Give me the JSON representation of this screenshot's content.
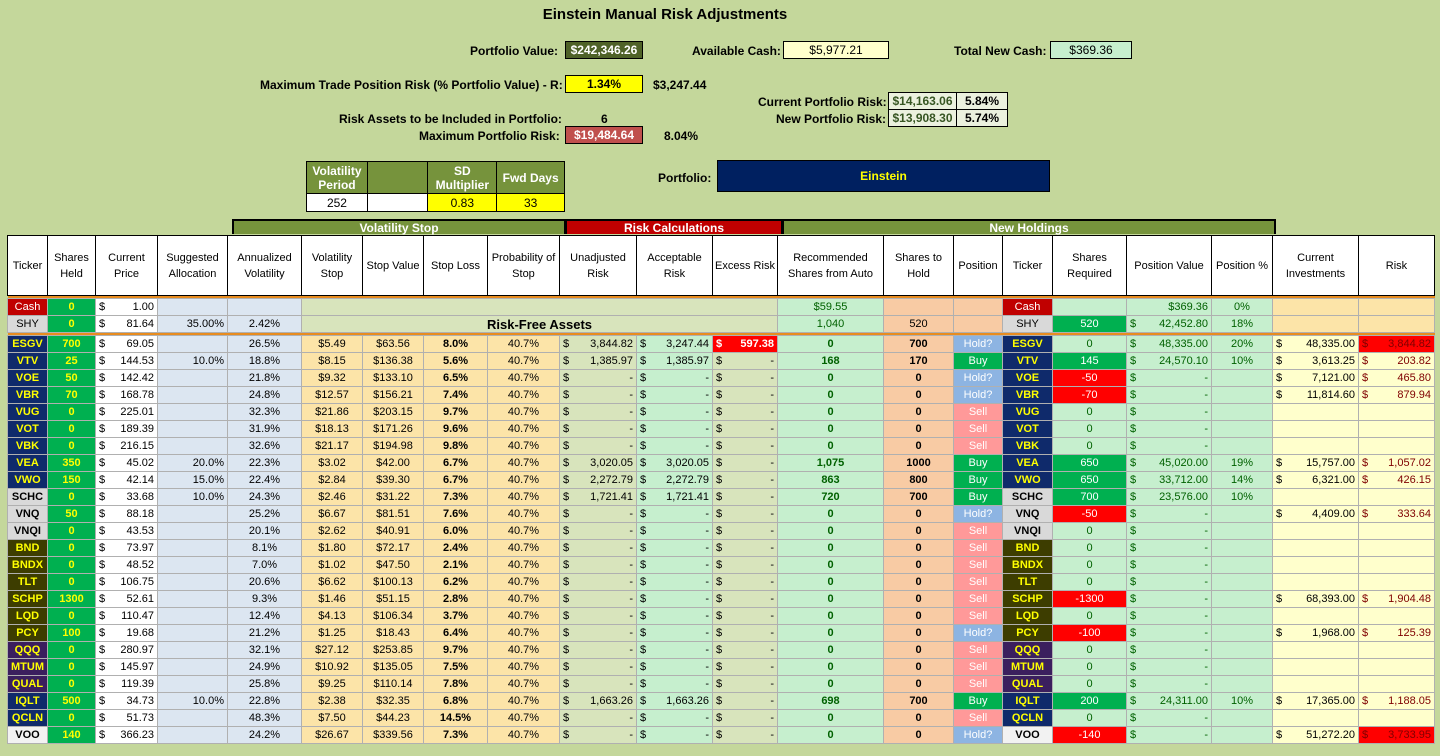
{
  "title": "Einstein Manual Risk Adjustments",
  "summary": {
    "portfolio_value_label": "Portfolio Value:",
    "portfolio_value": "$242,346.26",
    "available_cash_label": "Available Cash:",
    "available_cash": "$5,977.21",
    "total_new_cash_label": "Total New Cash:",
    "total_new_cash": "$369.36",
    "max_trade_label": "Maximum Trade Position Risk (% Portfolio Value) - R:",
    "max_trade_pct": "1.34%",
    "max_trade_value": "$3,247.44",
    "current_risk_label": "Current Portfolio Risk:",
    "current_risk_value": "$14,163.06",
    "current_risk_pct": "5.84%",
    "new_risk_label": "New Portfolio Risk:",
    "new_risk_value": "$13,908.30",
    "new_risk_pct": "5.74%",
    "risk_assets_label": "Risk Assets to be Included in Portfolio:",
    "risk_assets": "6",
    "max_portfolio_risk_label": "Maximum Portfolio Risk:",
    "max_portfolio_risk": "$19,484.64",
    "max_portfolio_risk_pct": "8.04%",
    "portfolio_label": "Portfolio:",
    "portfolio_name": "Einstein"
  },
  "vol_table": {
    "h1": "Volatility Period",
    "h2": "SD Multiplier",
    "h3": "Fwd Days",
    "v1": "252",
    "v2": "0.83",
    "v3": "33"
  },
  "sections": {
    "vol_stop": "Volatility Stop",
    "risk_calc": "Risk Calculations",
    "new_holdings": "New Holdings"
  },
  "headers": [
    "Ticker",
    "Shares Held",
    "Current Price",
    "Suggested Allocation",
    "Annualized Volatility",
    "Volatility Stop",
    "Stop Value",
    "Stop Loss",
    "Probability of Stop",
    "Unadjusted Risk",
    "Acceptable Risk",
    "Excess Risk",
    "Recommended Shares from Auto",
    "Shares to Hold",
    "Position",
    "Ticker",
    "Shares Required",
    "Position Value",
    "Position %",
    "Current Investments",
    "Risk"
  ],
  "cash_row": {
    "ticker": "Cash",
    "shares": "0",
    "price": "1.00",
    "recommended": "$59.55",
    "ticker2": "Cash",
    "position_value": "$369.36",
    "position_pct": "0%"
  },
  "shy_row": {
    "ticker": "SHY",
    "shares": "0",
    "price": "81.64",
    "allocation": "35.00%",
    "volatility": "2.42%",
    "risk_free_label": "Risk-Free Assets",
    "recommended": "1,040",
    "hold": "520",
    "ticker2": "SHY",
    "required": "520",
    "position_value": "42,452.80",
    "position_pct": "18%"
  },
  "rows": [
    [
      "ESGV",
      "700",
      "69.05",
      "",
      "26.5%",
      "$5.49",
      "$63.56",
      "8.0%",
      "40.7%",
      "3,844.82",
      "3,247.44",
      "597.38",
      "0",
      "700",
      "Hold?",
      "ESGV",
      "0",
      "48,335.00",
      "20%",
      "48,335.00",
      "3,844.82"
    ],
    [
      "VTV",
      "25",
      "144.53",
      "10.0%",
      "18.8%",
      "$8.15",
      "$136.38",
      "5.6%",
      "40.7%",
      "1,385.97",
      "1,385.97",
      "-",
      "168",
      "170",
      "Buy",
      "VTV",
      "145",
      "24,570.10",
      "10%",
      "3,613.25",
      "203.82"
    ],
    [
      "VOE",
      "50",
      "142.42",
      "",
      "21.8%",
      "$9.32",
      "$133.10",
      "6.5%",
      "40.7%",
      "-",
      "-",
      "-",
      "0",
      "0",
      "Hold?",
      "VOE",
      "-50",
      "-",
      "",
      "7,121.00",
      "465.80"
    ],
    [
      "VBR",
      "70",
      "168.78",
      "",
      "24.8%",
      "$12.57",
      "$156.21",
      "7.4%",
      "40.7%",
      "-",
      "-",
      "-",
      "0",
      "0",
      "Hold?",
      "VBR",
      "-70",
      "-",
      "",
      "11,814.60",
      "879.94"
    ],
    [
      "VUG",
      "0",
      "225.01",
      "",
      "32.3%",
      "$21.86",
      "$203.15",
      "9.7%",
      "40.7%",
      "-",
      "-",
      "-",
      "0",
      "0",
      "Sell",
      "VUG",
      "0",
      "-",
      "",
      "",
      ""
    ],
    [
      "VOT",
      "0",
      "189.39",
      "",
      "31.9%",
      "$18.13",
      "$171.26",
      "9.6%",
      "40.7%",
      "-",
      "-",
      "-",
      "0",
      "0",
      "Sell",
      "VOT",
      "0",
      "-",
      "",
      "",
      ""
    ],
    [
      "VBK",
      "0",
      "216.15",
      "",
      "32.6%",
      "$21.17",
      "$194.98",
      "9.8%",
      "40.7%",
      "-",
      "-",
      "-",
      "0",
      "0",
      "Sell",
      "VBK",
      "0",
      "-",
      "",
      "",
      ""
    ],
    [
      "VEA",
      "350",
      "45.02",
      "20.0%",
      "22.3%",
      "$3.02",
      "$42.00",
      "6.7%",
      "40.7%",
      "3,020.05",
      "3,020.05",
      "-",
      "1,075",
      "1000",
      "Buy",
      "VEA",
      "650",
      "45,020.00",
      "19%",
      "15,757.00",
      "1,057.02"
    ],
    [
      "VWO",
      "150",
      "42.14",
      "15.0%",
      "22.4%",
      "$2.84",
      "$39.30",
      "6.7%",
      "40.7%",
      "2,272.79",
      "2,272.79",
      "-",
      "863",
      "800",
      "Buy",
      "VWO",
      "650",
      "33,712.00",
      "14%",
      "6,321.00",
      "426.15"
    ],
    [
      "SCHC",
      "0",
      "33.68",
      "10.0%",
      "24.3%",
      "$2.46",
      "$31.22",
      "7.3%",
      "40.7%",
      "1,721.41",
      "1,721.41",
      "-",
      "720",
      "700",
      "Buy",
      "SCHC",
      "700",
      "23,576.00",
      "10%",
      "",
      ""
    ],
    [
      "VNQ",
      "50",
      "88.18",
      "",
      "25.2%",
      "$6.67",
      "$81.51",
      "7.6%",
      "40.7%",
      "-",
      "-",
      "-",
      "0",
      "0",
      "Hold?",
      "VNQ",
      "-50",
      "-",
      "",
      "4,409.00",
      "333.64"
    ],
    [
      "VNQI",
      "0",
      "43.53",
      "",
      "20.1%",
      "$2.62",
      "$40.91",
      "6.0%",
      "40.7%",
      "-",
      "-",
      "-",
      "0",
      "0",
      "Sell",
      "VNQI",
      "0",
      "-",
      "",
      "",
      ""
    ],
    [
      "BND",
      "0",
      "73.97",
      "",
      "8.1%",
      "$1.80",
      "$72.17",
      "2.4%",
      "40.7%",
      "-",
      "-",
      "-",
      "0",
      "0",
      "Sell",
      "BND",
      "0",
      "-",
      "",
      "",
      ""
    ],
    [
      "BNDX",
      "0",
      "48.52",
      "",
      "7.0%",
      "$1.02",
      "$47.50",
      "2.1%",
      "40.7%",
      "-",
      "-",
      "-",
      "0",
      "0",
      "Sell",
      "BNDX",
      "0",
      "-",
      "",
      "",
      ""
    ],
    [
      "TLT",
      "0",
      "106.75",
      "",
      "20.6%",
      "$6.62",
      "$100.13",
      "6.2%",
      "40.7%",
      "-",
      "-",
      "-",
      "0",
      "0",
      "Sell",
      "TLT",
      "0",
      "-",
      "",
      "",
      ""
    ],
    [
      "SCHP",
      "1300",
      "52.61",
      "",
      "9.3%",
      "$1.46",
      "$51.15",
      "2.8%",
      "40.7%",
      "-",
      "-",
      "-",
      "0",
      "0",
      "Sell",
      "SCHP",
      "-1300",
      "-",
      "",
      "68,393.00",
      "1,904.48"
    ],
    [
      "LQD",
      "0",
      "110.47",
      "",
      "12.4%",
      "$4.13",
      "$106.34",
      "3.7%",
      "40.7%",
      "-",
      "-",
      "-",
      "0",
      "0",
      "Sell",
      "LQD",
      "0",
      "-",
      "",
      "",
      ""
    ],
    [
      "PCY",
      "100",
      "19.68",
      "",
      "21.2%",
      "$1.25",
      "$18.43",
      "6.4%",
      "40.7%",
      "-",
      "-",
      "-",
      "0",
      "0",
      "Hold?",
      "PCY",
      "-100",
      "-",
      "",
      "1,968.00",
      "125.39"
    ],
    [
      "QQQ",
      "0",
      "280.97",
      "",
      "32.1%",
      "$27.12",
      "$253.85",
      "9.7%",
      "40.7%",
      "-",
      "-",
      "-",
      "0",
      "0",
      "Sell",
      "QQQ",
      "0",
      "-",
      "",
      "",
      ""
    ],
    [
      "MTUM",
      "0",
      "145.97",
      "",
      "24.9%",
      "$10.92",
      "$135.05",
      "7.5%",
      "40.7%",
      "-",
      "-",
      "-",
      "0",
      "0",
      "Sell",
      "MTUM",
      "0",
      "-",
      "",
      "",
      ""
    ],
    [
      "QUAL",
      "0",
      "119.39",
      "",
      "25.8%",
      "$9.25",
      "$110.14",
      "7.8%",
      "40.7%",
      "-",
      "-",
      "-",
      "0",
      "0",
      "Sell",
      "QUAL",
      "0",
      "-",
      "",
      "",
      ""
    ],
    [
      "IQLT",
      "500",
      "34.73",
      "10.0%",
      "22.8%",
      "$2.38",
      "$32.35",
      "6.8%",
      "40.7%",
      "1,663.26",
      "1,663.26",
      "-",
      "698",
      "700",
      "Buy",
      "IQLT",
      "200",
      "24,311.00",
      "10%",
      "17,365.00",
      "1,188.05"
    ],
    [
      "QCLN",
      "0",
      "51.73",
      "",
      "48.3%",
      "$7.50",
      "$44.23",
      "14.5%",
      "40.7%",
      "-",
      "-",
      "-",
      "0",
      "0",
      "Sell",
      "QCLN",
      "0",
      "-",
      "",
      "",
      ""
    ],
    [
      "VOO",
      "140",
      "366.23",
      "",
      "24.2%",
      "$26.67",
      "$339.56",
      "7.3%",
      "40.7%",
      "-",
      "-",
      "-",
      "0",
      "0",
      "Hold?",
      "VOO",
      "-140",
      "-",
      "",
      "51,272.20",
      "3,733.95"
    ]
  ],
  "colors": {
    "ticker_yellow_on_navy": "#0f2a6b",
    "ticker_yellow_on_olive": "#3d3d00",
    "ticker_yellow_on_purple": "#3b1f5e",
    "buy": "#00b050",
    "sell": "#ff9999",
    "hold": "#8db4e2",
    "negative": "#ff0000"
  }
}
